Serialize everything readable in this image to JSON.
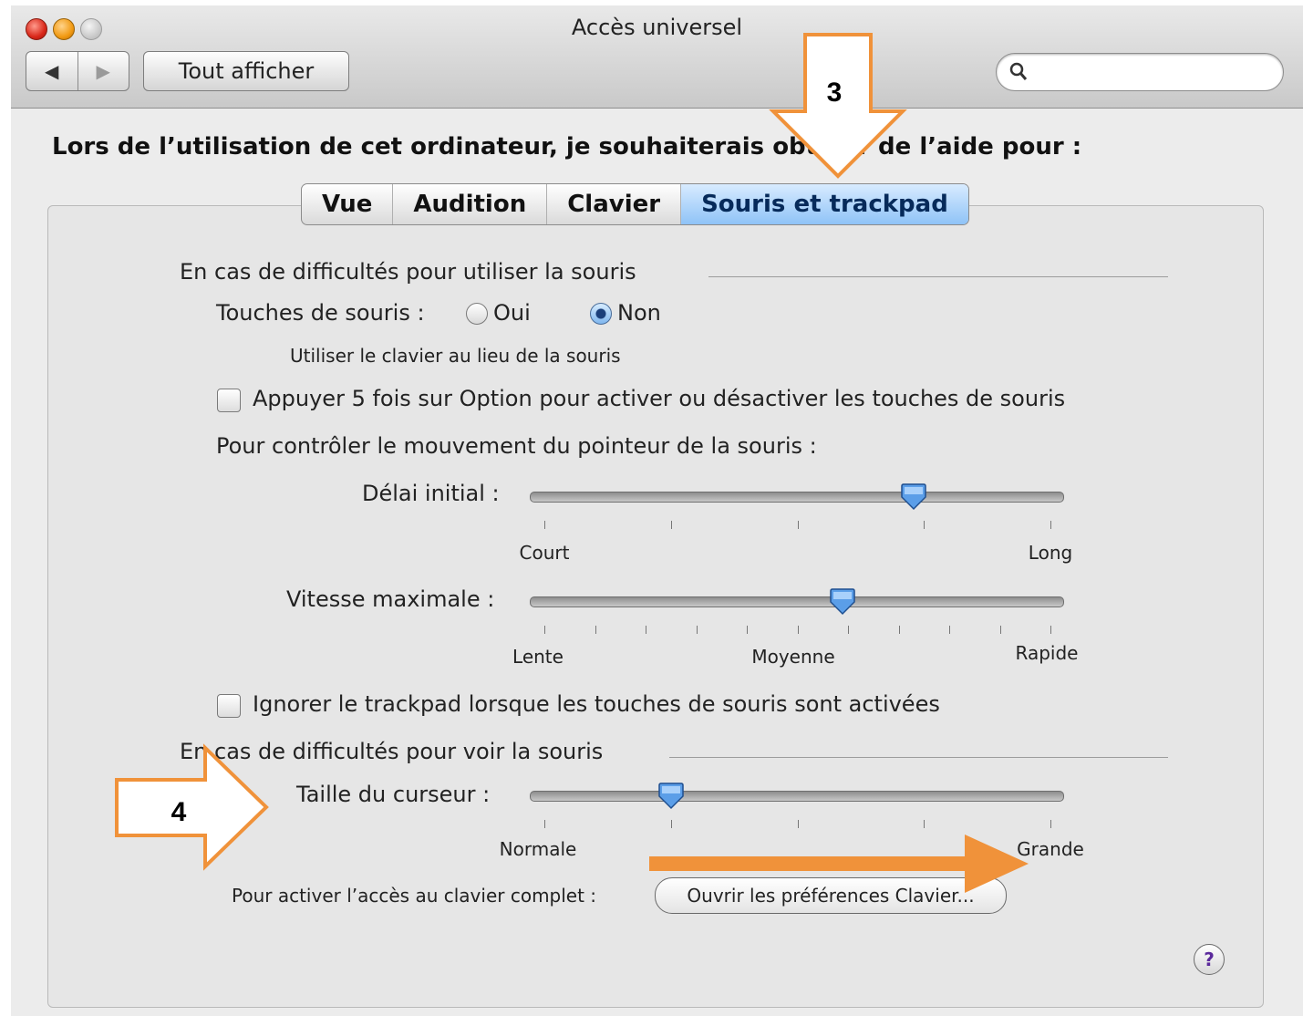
{
  "window": {
    "title": "Accès universel"
  },
  "toolbar": {
    "back_icon": "back-arrow-icon",
    "forward_icon": "forward-arrow-icon",
    "show_all_label": "Tout afficher",
    "search_placeholder": ""
  },
  "heading": "Lors de l’utilisation de cet ordinateur, je souhaiterais obtenir de l’aide pour :",
  "tabs": [
    {
      "label": "Vue"
    },
    {
      "label": "Audition"
    },
    {
      "label": "Clavier"
    },
    {
      "label": "Souris et trackpad",
      "selected": true
    }
  ],
  "mouse_use": {
    "section_title": "En cas de difficultés pour utiliser la souris",
    "mouse_keys_label": "Touches de souris :",
    "yes_label": "Oui",
    "no_label": "Non",
    "selected": "Non",
    "mouse_keys_hint": "Utiliser le clavier au lieu de la souris",
    "option_toggle_label": "Appuyer 5 fois sur Option pour activer ou désactiver les touches de souris",
    "option_toggle_checked": false,
    "pointer_control_label": "Pour contrôler le mouvement du pointeur de la souris :",
    "initial_delay": {
      "label": "Délai initial :",
      "min_label": "Court",
      "max_label": "Long",
      "ticks": 5,
      "value": 0.73
    },
    "max_speed": {
      "label": "Vitesse maximale :",
      "min_label": "Lente",
      "mid_label": "Moyenne",
      "max_label": "Rapide",
      "ticks": 11,
      "value": 0.59
    },
    "ignore_trackpad_label": "Ignorer le trackpad lorsque les touches de souris sont activées",
    "ignore_trackpad_checked": false
  },
  "mouse_see": {
    "section_title": "En cas de difficultés pour voir la souris",
    "cursor_size": {
      "label": "Taille du curseur :",
      "min_label": "Normale",
      "max_label": "Grande",
      "ticks": 5,
      "value": 0.25
    }
  },
  "keyboard_access": {
    "label": "Pour activer l’accès au clavier complet :",
    "button_label": "Ouvrir les préférences Clavier..."
  },
  "help_label": "?",
  "annotations": [
    {
      "number": "3",
      "color": "#f0923a"
    },
    {
      "number": "4",
      "color": "#f0923a"
    }
  ]
}
